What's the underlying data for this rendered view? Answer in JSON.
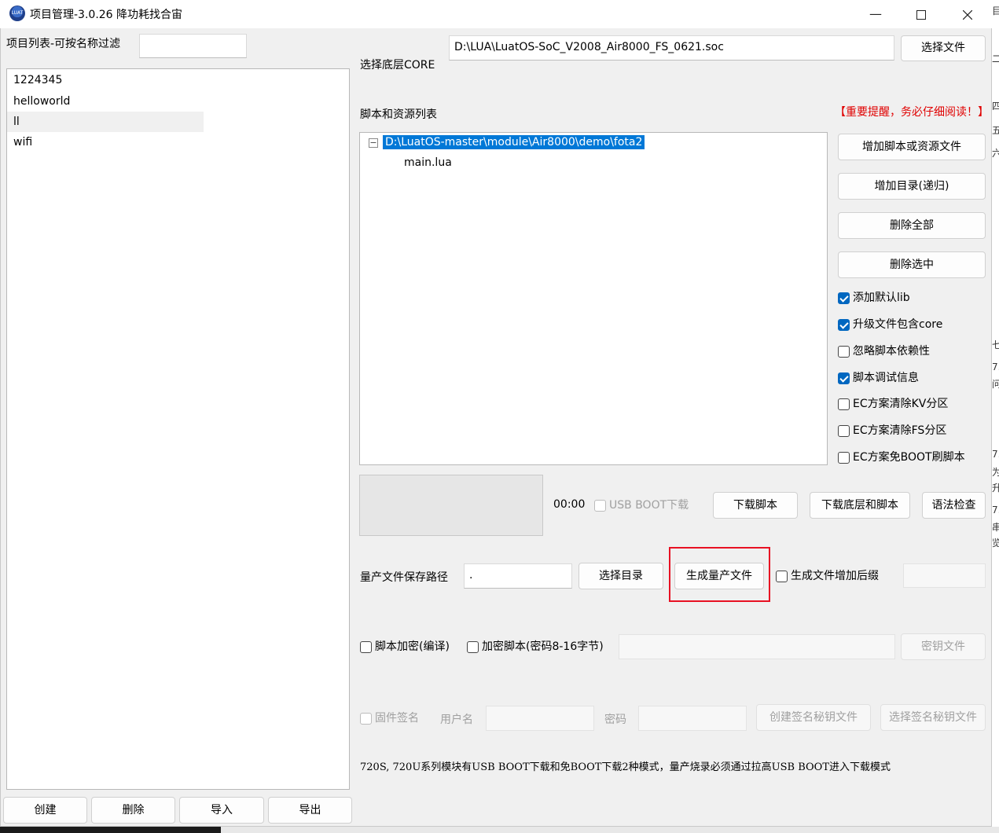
{
  "window": {
    "title": "项目管理-3.0.26 降功耗找合宙",
    "minimize_glyph": "—",
    "icon": "luat-app-icon"
  },
  "project_list": {
    "filter_label": "项目列表-可按名称过滤",
    "filter_value": "",
    "items": [
      "1224345",
      "helloworld",
      "ll",
      "wifi"
    ],
    "selected_index": 2,
    "buttons": {
      "create": "创建",
      "delete": "删除",
      "import": "导入",
      "export": "导出"
    }
  },
  "core": {
    "label": "选择底层CORE",
    "path": "D:\\LUA\\LuatOS-SoC_V2008_Air8000_FS_0621.soc",
    "select_button": "选择文件"
  },
  "scripts": {
    "label": "脚本和资源列表",
    "warning": "【重要提醒，务必仔细阅读！】",
    "tree_root": "D:\\LuatOS-master\\module\\Air8000\\demo\\fota2",
    "tree_child": "main.lua",
    "collapse_glyph": "−",
    "buttons": {
      "add_file": "增加脚本或资源文件",
      "add_dir": "增加目录(递归)",
      "delete_all": "删除全部",
      "delete_selected": "删除选中"
    },
    "options": [
      {
        "label": "添加默认lib",
        "checked": true
      },
      {
        "label": "升级文件包含core",
        "checked": true
      },
      {
        "label": "忽略脚本依赖性",
        "checked": false
      },
      {
        "label": "脚本调试信息",
        "checked": true
      },
      {
        "label": "EC方案清除KV分区",
        "checked": false
      },
      {
        "label": "EC方案清除FS分区",
        "checked": false
      },
      {
        "label": "EC方案免BOOT刷脚本",
        "checked": false
      }
    ]
  },
  "download": {
    "timer": "00:00",
    "usb_boot_label": "USB BOOT下载",
    "download_script": "下载脚本",
    "download_core_script": "下载底层和脚本",
    "syntax_check": "语法检查"
  },
  "mass_production": {
    "path_label": "量产文件保存路径",
    "path_value": ".",
    "select_dir": "选择目录",
    "generate": "生成量产文件",
    "suffix_label": "生成文件增加后缀",
    "suffix_value": ""
  },
  "encryption": {
    "compile_label": "脚本加密(编译)",
    "encrypt_label": "加密脚本(密码8-16字节)",
    "password_value": "",
    "key_file": "密钥文件"
  },
  "signing": {
    "firmware_sign": "固件签名",
    "username_label": "用户名",
    "username_value": "",
    "password_label": "密码",
    "password_value": "",
    "create_key": "创建签名秘钥文件",
    "select_key": "选择签名秘钥文件"
  },
  "note": "720S, 720U系列模块有USB BOOT下载和免BOOT下载2种模式，量产烧录必须通过拉高USB BOOT进入下载模式",
  "edge_fragments": [
    "目",
    "二",
    "四",
    "五",
    "六",
    "七",
    "7.",
    "问",
    "7.",
    "为",
    "升",
    "7.",
    "串",
    "览"
  ],
  "colors": {
    "highlight": "#e81123",
    "warning": "#e00000",
    "selection": "#0078d7",
    "check": "#0067c0"
  }
}
